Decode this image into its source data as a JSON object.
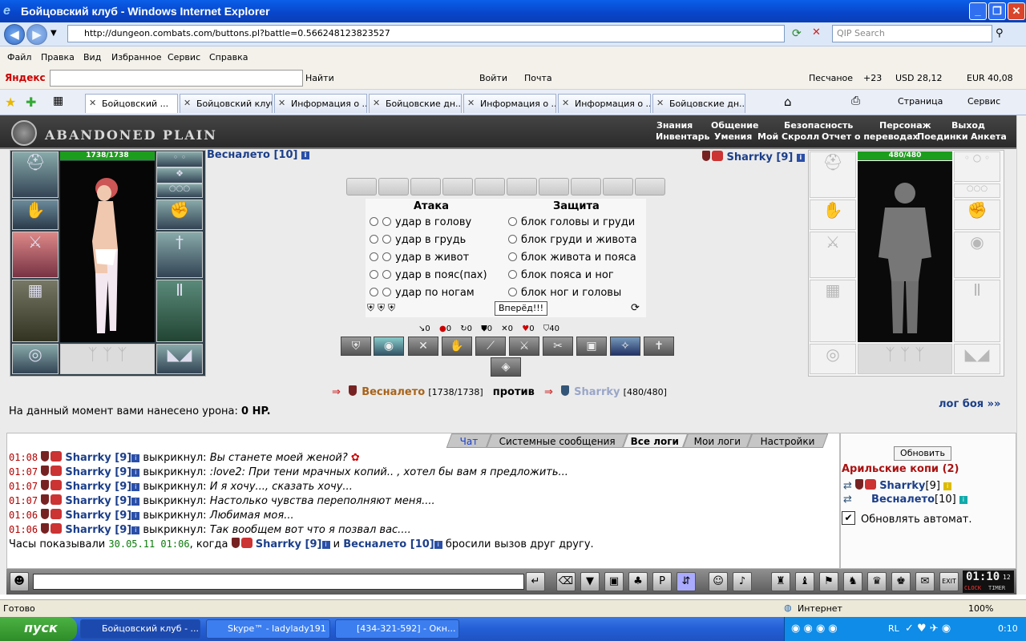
{
  "window": {
    "title": "Бойцовский клуб - Windows Internet Explorer"
  },
  "addressbar": {
    "url": "http://dungeon.combats.com/buttons.pl?battle=0.566248123823527",
    "search_placeholder": "QIP Search"
  },
  "menu": [
    "Файл",
    "Правка",
    "Вид",
    "Избранное",
    "Сервис",
    "Справка"
  ],
  "yandex": {
    "label": "Яндекс",
    "find": "Найти",
    "login": "Войти",
    "mail": "Почта",
    "weather": "Песчаное",
    "temp": "+23",
    "usd": "USD 28,12",
    "eur": "EUR 40,08"
  },
  "tabs": [
    "Бойцовский ...",
    "Бойцовский клуб.",
    "Информация о ...",
    "Бойцовские дн...",
    "Информация о ...",
    "Информация о ...",
    "Бойцовские дн..."
  ],
  "ie_tools": {
    "page": "Страница",
    "service": "Сервис"
  },
  "game": {
    "logo": "ABANDONED PLAIN",
    "nav_top": [
      "Знания",
      "Общение",
      "Безопасность",
      "Персонаж",
      "Выход"
    ],
    "nav_bottom": [
      "Инвентарь",
      "Умения",
      "Мой Скролл",
      "Отчет о переводах",
      "Поединки",
      "Анкета"
    ],
    "player": {
      "name": "Весналето [10]",
      "hp": "1738/1738"
    },
    "enemy": {
      "name": "Sharrky [9]",
      "hp": "480/480"
    },
    "attack_header": "Атака",
    "defense_header": "Защита",
    "attacks": [
      "удар в голову",
      "удар в грудь",
      "удар в живот",
      "удар в пояс(пах)",
      "удар по ногам"
    ],
    "blocks": [
      "блок головы и груди",
      "блок груди и живота",
      "блок живота и пояса",
      "блок пояса и ног",
      "блок ног и головы"
    ],
    "go_button": "Вперёд!!!",
    "stats": [
      "0",
      "0",
      "0",
      "0",
      "0",
      "0",
      "40"
    ],
    "versus": {
      "p1": "Весналето",
      "p1hp": "[1738/1738]",
      "vs": "против",
      "p2": "Sharrky",
      "p2hp": "[480/480]"
    },
    "damage_prefix": "На данный момент вами нанесено урона:",
    "damage_value": "0 HP.",
    "battle_log": "лог боя »»"
  },
  "chat": {
    "tabs": [
      "Чат",
      "Системные сообщения",
      "Все логи",
      "Мои логи",
      "Настройки"
    ],
    "lines": [
      {
        "time": "01:08",
        "nick": "Sharrky [9]",
        "verb": "выкрикнул:",
        "text": "Вы станете моей женой?"
      },
      {
        "time": "01:07",
        "nick": "Sharrky [9]",
        "verb": "выкрикнул:",
        "text": ":love2: При тени мрачных копий.. , хотел бы вам я предложить..."
      },
      {
        "time": "01:07",
        "nick": "Sharrky [9]",
        "verb": "выкрикнул:",
        "text": "И я хочу..., сказать хочу..."
      },
      {
        "time": "01:07",
        "nick": "Sharrky [9]",
        "verb": "выкрикнул:",
        "text": "Настолько чувства переполняют меня...."
      },
      {
        "time": "01:06",
        "nick": "Sharrky [9]",
        "verb": "выкрикнул:",
        "text": "Любимая моя..."
      },
      {
        "time": "01:06",
        "nick": "Sharrky [9]",
        "verb": "выкрикнул:",
        "text": "Так вообщем вот что я позвал вас...."
      }
    ],
    "final": {
      "prefix": "Часы показывали",
      "datetime": "30.05.11 01:06",
      "when": ", когда",
      "p2": "Sharrky [9]",
      "and": "и",
      "p1": "Весналето [10]",
      "suffix": "бросили вызов друг другу."
    }
  },
  "side": {
    "refresh": "Обновить",
    "location": "Арильские копи (2)",
    "u1": "Sharrky",
    "u1lvl": "[9]",
    "u2": "Весналето",
    "u2lvl": "[10]",
    "auto": "Обновлять автомат."
  },
  "clock": {
    "time": "01:10",
    "sec": "12",
    "clock": "CLOCK",
    "timer": "TIMER"
  },
  "status": {
    "ready": "Готово",
    "zone": "Интернет",
    "zoom": "100%"
  },
  "taskbar": {
    "start": "пуск",
    "items": [
      "Бойцовский клуб - ...",
      "Skype™ - ladylady191",
      "[434-321-592] - Окн..."
    ],
    "lang": "RL",
    "time": "0:10"
  }
}
